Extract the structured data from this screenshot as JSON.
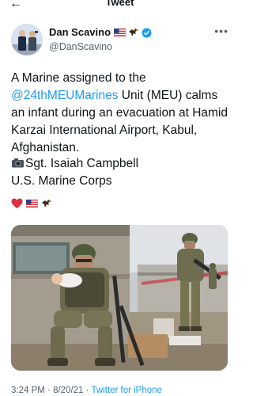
{
  "topbar": {
    "back_icon": "back-arrow-icon",
    "title": "Tweet"
  },
  "author": {
    "display_name": "Dan Scavino",
    "handle": "@DanScavino",
    "badges": [
      "us-flag-emoji",
      "eagle-emoji",
      "verified-badge-icon"
    ],
    "verified_color": "#1d9bf0"
  },
  "tweet": {
    "text_before": "A Marine assigned to the ",
    "mention": "@24thMEUMarines",
    "text_after": " Unit (MEU) calms an infant during an evacuation at Hamid Karzai International Airport, Kabul, Afghanistan.",
    "credit_name": "Sgt. Isaiah Campbell",
    "credit_org": "U.S. Marine Corps",
    "emoji_row": [
      "red-heart-emoji",
      "us-flag-emoji",
      "eagle-emoji"
    ]
  },
  "media": {
    "type": "photo",
    "subject": "marine-holding-infant"
  },
  "meta": {
    "time": "3:24 PM",
    "separator": " · ",
    "date": "8/20/21",
    "separator2": " · ",
    "source": "Twitter for iPhone"
  },
  "colors": {
    "accent": "#1d9bf0",
    "text": "#0f1419",
    "secondary_text": "#536471"
  }
}
